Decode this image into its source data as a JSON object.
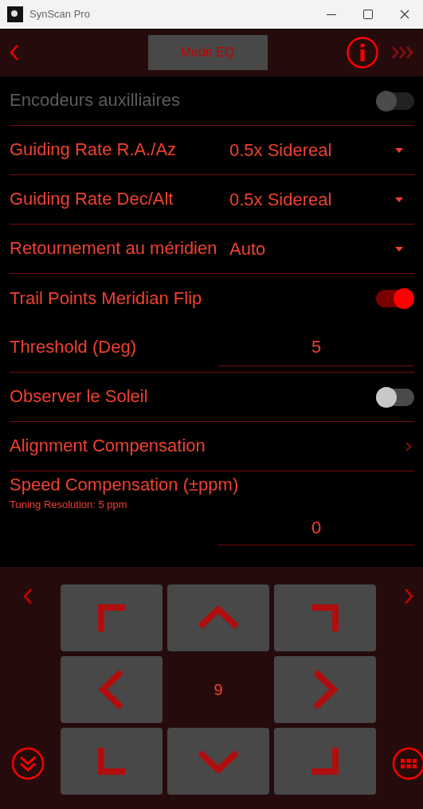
{
  "window": {
    "title": "SynScan Pro"
  },
  "header": {
    "mode_button": "Mode EQ"
  },
  "settings": [
    {
      "kind": "toggle",
      "label": "Encodeurs auxilliaires",
      "on": false,
      "disabled": true
    },
    {
      "kind": "select",
      "label": "Guiding Rate R.A./Az",
      "value": "0.5x Sidereal",
      "disabled": false
    },
    {
      "kind": "select",
      "label": "Guiding Rate Dec/Alt",
      "value": "0.5x Sidereal",
      "disabled": false
    },
    {
      "kind": "select",
      "label": "Retournement au méridien",
      "value": "Auto",
      "disabled": false
    },
    {
      "kind": "toggle",
      "label": "Trail Points Meridian Flip",
      "on": true,
      "disabled": false,
      "divider": false
    },
    {
      "kind": "number",
      "label": "Threshold (Deg)",
      "value": "5",
      "disabled": false
    },
    {
      "kind": "toggle",
      "label": "Observer le Soleil",
      "on": false,
      "disabled": false
    },
    {
      "kind": "link",
      "label": "Alignment Compensation",
      "disabled": false
    },
    {
      "kind": "number",
      "label": "Speed Compensation (±ppm)",
      "hint": "Tuning Resolution: 5 ppm",
      "value": "0",
      "disabled": false,
      "divider": false
    }
  ],
  "pad": {
    "rate": "9"
  }
}
